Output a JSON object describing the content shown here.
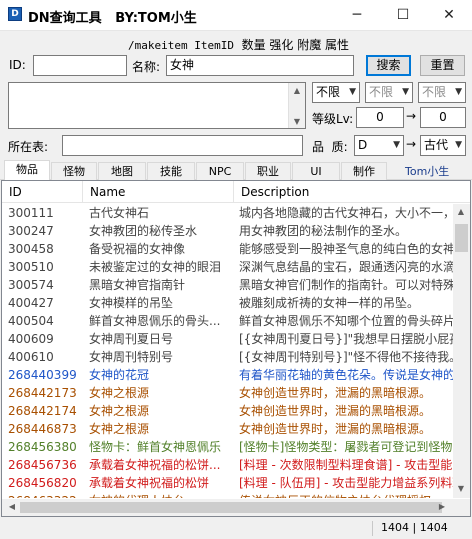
{
  "window": {
    "title": "DN查询工具   BY:TOM小生",
    "minimize": "─",
    "maximize": "☐",
    "close": "✕"
  },
  "command": {
    "code": "/makeitem ItemID",
    "rest": "  数量 强化 附魔 属性"
  },
  "form": {
    "id_label": "ID:",
    "id_value": "",
    "name_label": "名称:",
    "name_value": "女神",
    "search_button": "搜索",
    "reset_button": "重置",
    "filter1": "不限",
    "filter2": "不限",
    "filter3": "不限",
    "level_label": "等级Lv:",
    "level_from": "0",
    "level_to": "0",
    "arrow": "→",
    "table_label": "所在表:",
    "table_value": "",
    "quality_label": "品  质:",
    "quality_from": "D",
    "quality_to": "古代"
  },
  "tabs": [
    "物品",
    "怪物",
    "地图",
    "技能",
    "NPC",
    "职业",
    "UI",
    "制作"
  ],
  "tom_tab": "Tom小生",
  "table": {
    "columns": [
      "ID",
      "Name",
      "Description"
    ],
    "rows": [
      {
        "id": "300111",
        "name": "古代女神石",
        "desc": "城内各地隐藏的古代女神石，大小不一，各",
        "color": "gray"
      },
      {
        "id": "300247",
        "name": "女神教团的秘传圣水",
        "desc": "用女神教团的秘法制作的圣水。",
        "color": "gray"
      },
      {
        "id": "300458",
        "name": "备受祝福的女神像",
        "desc": "能够感受到一股神圣气息的纯白色的女神",
        "color": "gray"
      },
      {
        "id": "300510",
        "name": "未被鉴定过的女神的眼泪",
        "desc": "深渊气息结晶的宝石，跟通透闪亮的水滴",
        "color": "gray"
      },
      {
        "id": "300574",
        "name": "黑暗女神官指南针",
        "desc": "黑暗女神官们制作的指南针。可以对特殊",
        "color": "gray"
      },
      {
        "id": "400427",
        "name": "女神模样的吊坠",
        "desc": "被雕刻成祈祷的女神一样的吊坠。",
        "color": "gray"
      },
      {
        "id": "400504",
        "name": "鲜首女神恩佩乐的骨头...",
        "desc": "鲜首女神恩佩乐不知哪个位置的骨头碎片",
        "color": "gray"
      },
      {
        "id": "400609",
        "name": "女神周刊夏日号",
        "desc": "[{女神周刊夏日号}]\"我想早日摆脱小屁孩的",
        "color": "gray"
      },
      {
        "id": "400610",
        "name": "女神周刊特别号",
        "desc": "[{女神周刊特别号}]\"怪不得他不接待我。\"",
        "color": "gray"
      },
      {
        "id": "268440399",
        "name": "女神的花冠",
        "desc": "有着华丽花轴的黄色花朵。传说是女神的",
        "color": "blue"
      },
      {
        "id": "268442173",
        "name": "女神之根源",
        "desc": "女神创造世界时，泄漏的黑暗根源。",
        "color": "orange"
      },
      {
        "id": "268442174",
        "name": "女神之根源",
        "desc": "女神创造世界时，泄漏的黑暗根源。",
        "color": "orange"
      },
      {
        "id": "268446873",
        "name": "女神之根源",
        "desc": "女神创造世界时，泄漏的黑暗根源。",
        "color": "orange"
      },
      {
        "id": "268456380",
        "name": "怪物卡：鲜首女神恩佩乐",
        "desc": "[怪物卡]怪物类型：屠戮者可登记到怪物图",
        "color": "green"
      },
      {
        "id": "268456736",
        "name": "承载着女神祝福的松饼...",
        "desc": "[料理 - 次数限制型料理食谱] - 攻击型能",
        "color": "red"
      },
      {
        "id": "268456820",
        "name": "承载着女神祝福的松饼",
        "desc": "[料理 - 队伍用] - 攻击型能力增益系列料理",
        "color": "red"
      },
      {
        "id": "268463322",
        "name": "女神的代理人烛台",
        "desc": "传说女神巨正的信物之烛台代理授权",
        "color": "orange"
      }
    ]
  },
  "status": {
    "count": "1404 | 1404"
  },
  "colors": {
    "gray": "#444444",
    "blue": "#1e55c8",
    "orange": "#a84f00",
    "green": "#52802a",
    "red": "#d11b1b"
  }
}
